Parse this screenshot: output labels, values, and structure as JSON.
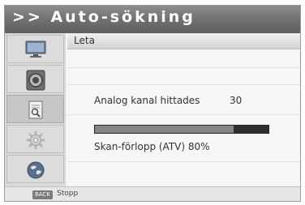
{
  "window": {
    "title": ">> Auto-sökning"
  },
  "sidebar": {
    "items": [
      {
        "icon": "tv-icon"
      },
      {
        "icon": "speaker-icon"
      },
      {
        "icon": "search-document-icon",
        "active": true
      },
      {
        "icon": "gear-icon"
      },
      {
        "icon": "globe-icon"
      }
    ]
  },
  "main": {
    "header_label": "Leta",
    "found_label": "Analog kanal hittades",
    "found_count": "30",
    "progress_percent": 80,
    "scan_label": "Skan-förlopp (ATV)  80%"
  },
  "footer": {
    "key_badge": "BACK",
    "key_label": "Stopp"
  }
}
